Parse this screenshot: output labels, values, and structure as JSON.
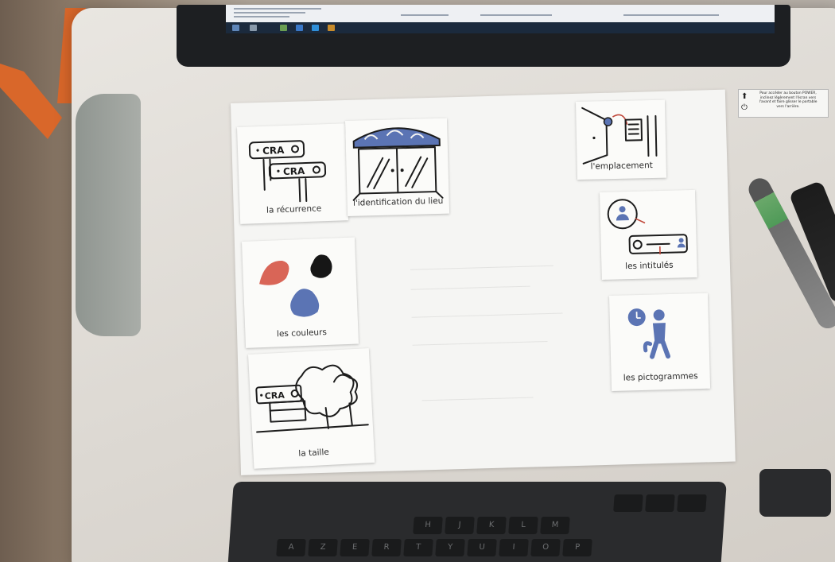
{
  "cards": {
    "recurrence": {
      "label": "la récurrence",
      "sign_top": "CRA",
      "sign_bottom": "CRA"
    },
    "identification": {
      "label": "l'identification du lieu"
    },
    "emplacement": {
      "label": "l'emplacement"
    },
    "intitules": {
      "label": "les intitulés"
    },
    "couleurs": {
      "label": "les couleurs"
    },
    "pictogrammes": {
      "label": "les pictogrammes"
    },
    "taille": {
      "label": "la taille",
      "sign": "CRA"
    }
  },
  "sticker": {
    "text": "Pour accéder au bouton POWER,\ninclinez légèrement l'écran vers\nl'avant et faire glisser le portable\nvers l'arrière."
  },
  "keyboard": {
    "keys_row1": [
      "A",
      "Z",
      "E",
      "R",
      "T",
      "Y",
      "U",
      "I",
      "O",
      "P"
    ],
    "keys_row2": [
      "H",
      "J",
      "K",
      "L",
      "M"
    ]
  },
  "colors": {
    "pictogram_blue": "#5b74b4",
    "card_red": "#d96557",
    "card_black": "#161616",
    "pen_green": "#5aa15f"
  }
}
